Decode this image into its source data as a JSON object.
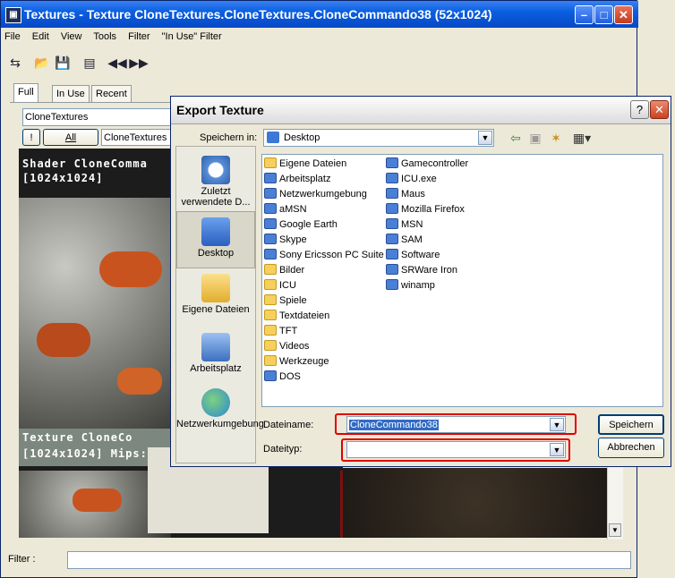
{
  "main": {
    "title": "Textures - Texture CloneTextures.CloneTextures.CloneCommando38 (52x1024)",
    "app_icon": "▣",
    "menu": [
      "File",
      "Edit",
      "View",
      "Tools",
      "Filter",
      "\"In Use\" Filter"
    ],
    "toolbar_icons": [
      "refresh-icon",
      "open-folder-icon",
      "save-icon",
      "properties-icon",
      "prev-icon",
      "next-icon"
    ],
    "tabs": [
      "Full",
      "In Use",
      "Recent"
    ],
    "package": "CloneTextures",
    "bang_label": "!",
    "all_label": "All",
    "group": "CloneTextures",
    "shader_top_line1": "Shader CloneComma",
    "shader_top_line2": "[1024x1024]",
    "shader_bottom_line1": "Texture CloneCo",
    "shader_bottom_line2": "[1024x1024] Mips:1",
    "filter_label": "Filter :",
    "filter_value": ""
  },
  "dialog": {
    "title": "Export Texture",
    "help_label": "?",
    "close_label": "✕",
    "save_in_label": "Speichern in:",
    "save_in_value": "Desktop",
    "places": [
      {
        "label": "Zuletzt verwendete D...",
        "icon": "recent-icon"
      },
      {
        "label": "Desktop",
        "icon": "desktop-icon"
      },
      {
        "label": "Eigene Dateien",
        "icon": "documents-icon"
      },
      {
        "label": "Arbeitsplatz",
        "icon": "computer-icon"
      },
      {
        "label": "Netzwerkumgebung",
        "icon": "network-icon"
      }
    ],
    "files_col1": [
      {
        "name": "Eigene Dateien",
        "type": "folder"
      },
      {
        "name": "Arbeitsplatz",
        "type": "prog"
      },
      {
        "name": "Netzwerkumgebung",
        "type": "prog"
      },
      {
        "name": "aMSN",
        "type": "prog"
      },
      {
        "name": "Google Earth",
        "type": "prog"
      },
      {
        "name": "Skype",
        "type": "prog"
      },
      {
        "name": "Sony Ericsson PC Suite",
        "type": "prog"
      },
      {
        "name": "Bilder",
        "type": "folder"
      },
      {
        "name": "ICU",
        "type": "folder"
      },
      {
        "name": "Spiele",
        "type": "folder"
      },
      {
        "name": "Textdateien",
        "type": "folder"
      },
      {
        "name": "TFT",
        "type": "folder"
      },
      {
        "name": "Videos",
        "type": "folder"
      },
      {
        "name": "Werkzeuge",
        "type": "folder"
      },
      {
        "name": "DOS",
        "type": "prog"
      }
    ],
    "files_col2": [
      {
        "name": "Gamecontroller",
        "type": "prog"
      },
      {
        "name": "ICU.exe",
        "type": "prog"
      },
      {
        "name": "Maus",
        "type": "prog"
      },
      {
        "name": "Mozilla Firefox",
        "type": "prog"
      },
      {
        "name": "MSN",
        "type": "prog"
      },
      {
        "name": "SAM",
        "type": "prog"
      },
      {
        "name": "Software",
        "type": "prog"
      },
      {
        "name": "SRWare Iron",
        "type": "prog"
      },
      {
        "name": "winamp",
        "type": "prog"
      }
    ],
    "filename_label": "Dateiname:",
    "filename_value": "CloneCommando38",
    "filetype_label": "Dateityp:",
    "filetype_value": "",
    "save_button": "Speichern",
    "cancel_button": "Abbrechen"
  },
  "colors": {
    "highlight": "#e00000",
    "selection": "#316ac5"
  }
}
